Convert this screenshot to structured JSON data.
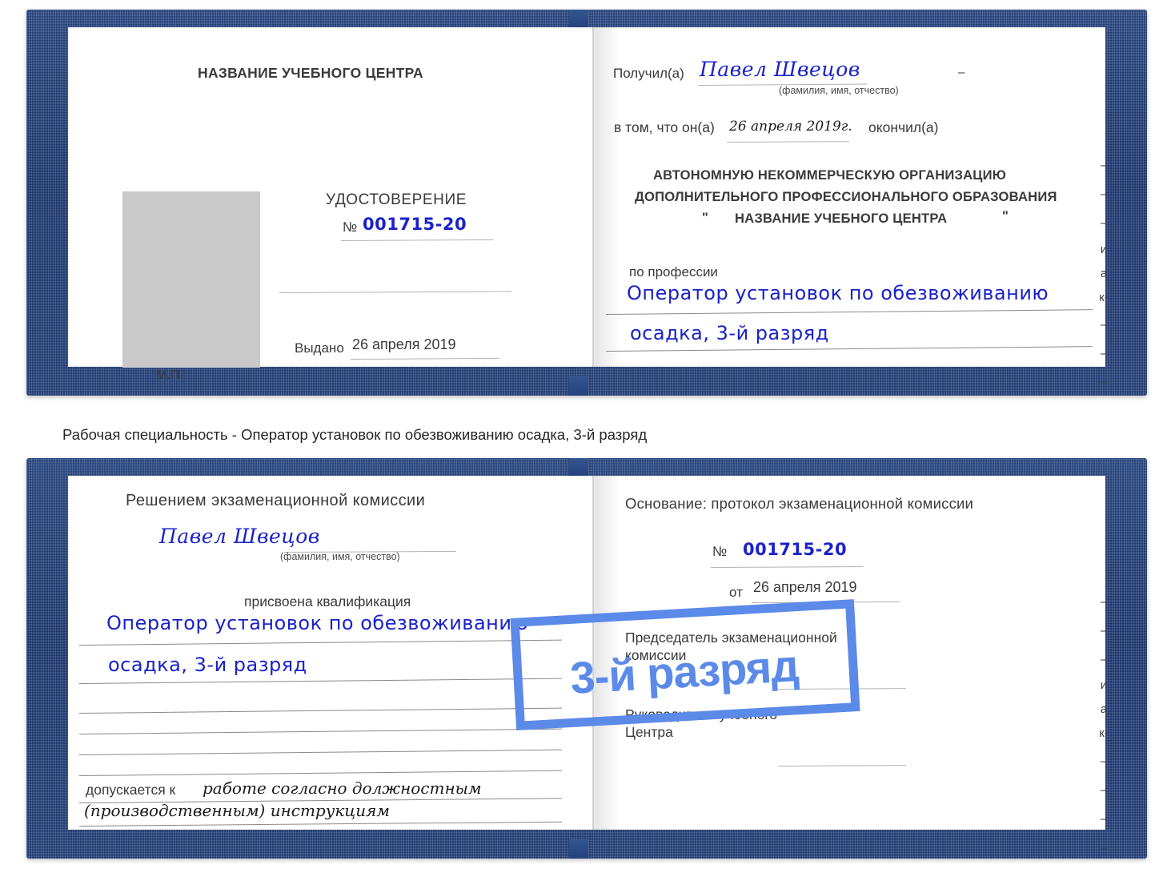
{
  "caption": "Рабочая специальность - Оператор установок по обезвоживанию осадка, 3-й разряд",
  "badge": {
    "label": "3-й разряд",
    "color": "#5b8ae8"
  },
  "colors": {
    "cover": "#1e3a75",
    "handwriting": "#1a22c8",
    "paper": "#ffffff",
    "rule": "#8a8a8a",
    "photo_placeholder": "#c9c9c9"
  },
  "certificate_top": {
    "left_page": {
      "center_name": "НАЗВАНИЕ УЧЕБНОГО ЦЕНТРА",
      "title": "УДОСТОВЕРЕНИЕ",
      "number_label": "№",
      "number_value": "001715-20",
      "issued_label": "Выдано",
      "issued_value": "26 апреля 2019",
      "stamp_label": "М.П."
    },
    "right_page": {
      "received_label": "Получил(а)",
      "received_value": "Павел Швецов",
      "fio_hint": "(фамилия, имя, отчество)",
      "in_that_label": "в том, что он(а)",
      "in_that_value": "26 апреля 2019г.",
      "finished_label": "окончил(а)",
      "org_line1": "АВТОНОМНУЮ НЕКОММЕРЧЕСКУЮ ОРГАНИЗАЦИЮ",
      "org_line2": "ДОПОЛНИТЕЛЬНОГО ПРОФЕССИОНАЛЬНОГО ОБРАЗОВАНИЯ",
      "org_quote_open": "\"",
      "org_line3": "НАЗВАНИЕ УЧЕБНОГО ЦЕНТРА",
      "org_quote_close": "\"",
      "profession_label": "по профессии",
      "profession_line1": "Оператор установок по обезвоживанию",
      "profession_line2": "осадка, 3-й разряд",
      "edge_column": [
        "–",
        "–",
        "–",
        "и",
        "а",
        "к-",
        "–",
        "–",
        "–"
      ]
    }
  },
  "certificate_bottom": {
    "left_page": {
      "heading": "Решением экзаменационной комиссии",
      "name_value": "Павел Швецов",
      "fio_hint": "(фамилия, имя, отчество)",
      "qualification_label": "присвоена квалификация",
      "qualification_line1": "Оператор установок по обезвоживанию",
      "qualification_line2": "осадка, 3-й разряд",
      "admitted_label": "допускается к",
      "admitted_line1": "работе согласно должностным",
      "admitted_line2": "(производственным) инструкциям"
    },
    "right_page": {
      "basis_label": "Основание: протокол экзаменационной комиссии",
      "number_label": "№",
      "number_value": "001715-20",
      "date_label": "от",
      "date_value": "26 апреля 2019",
      "chairman_line1": "Председатель экзаменационной",
      "chairman_line2": "комиссии",
      "head_line1": "Руководитель учебного",
      "head_line2": "Центра",
      "edge_column": [
        "–",
        "–",
        "–",
        "и",
        "а",
        "к-",
        "–",
        "–",
        "–",
        "–"
      ]
    }
  }
}
